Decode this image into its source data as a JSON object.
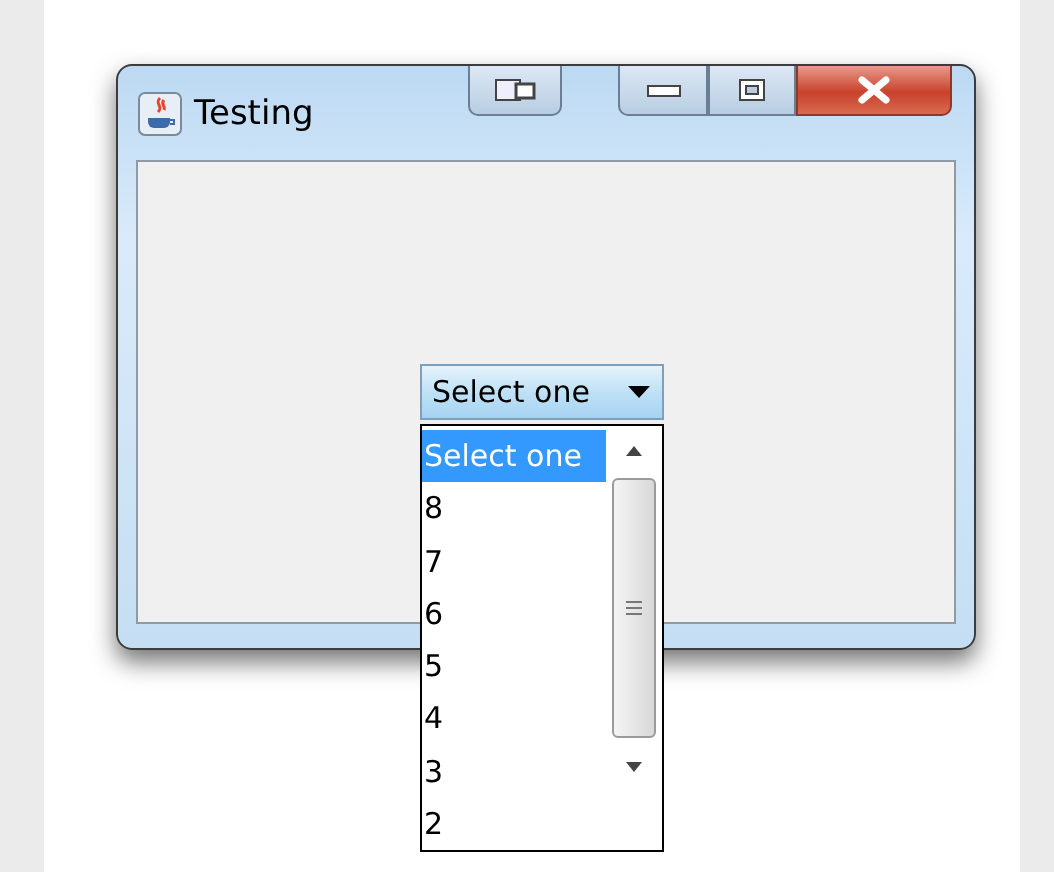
{
  "window": {
    "title": "Testing"
  },
  "combo_box": {
    "value": "Select one",
    "expanded": true
  },
  "dropdown_items": [
    {
      "label": "Select one",
      "selected": true
    },
    {
      "label": "8",
      "selected": false
    },
    {
      "label": "7",
      "selected": false
    },
    {
      "label": "6",
      "selected": false
    },
    {
      "label": "5",
      "selected": false
    },
    {
      "label": "4",
      "selected": false
    },
    {
      "label": "3",
      "selected": false
    },
    {
      "label": "2",
      "selected": false
    }
  ]
}
